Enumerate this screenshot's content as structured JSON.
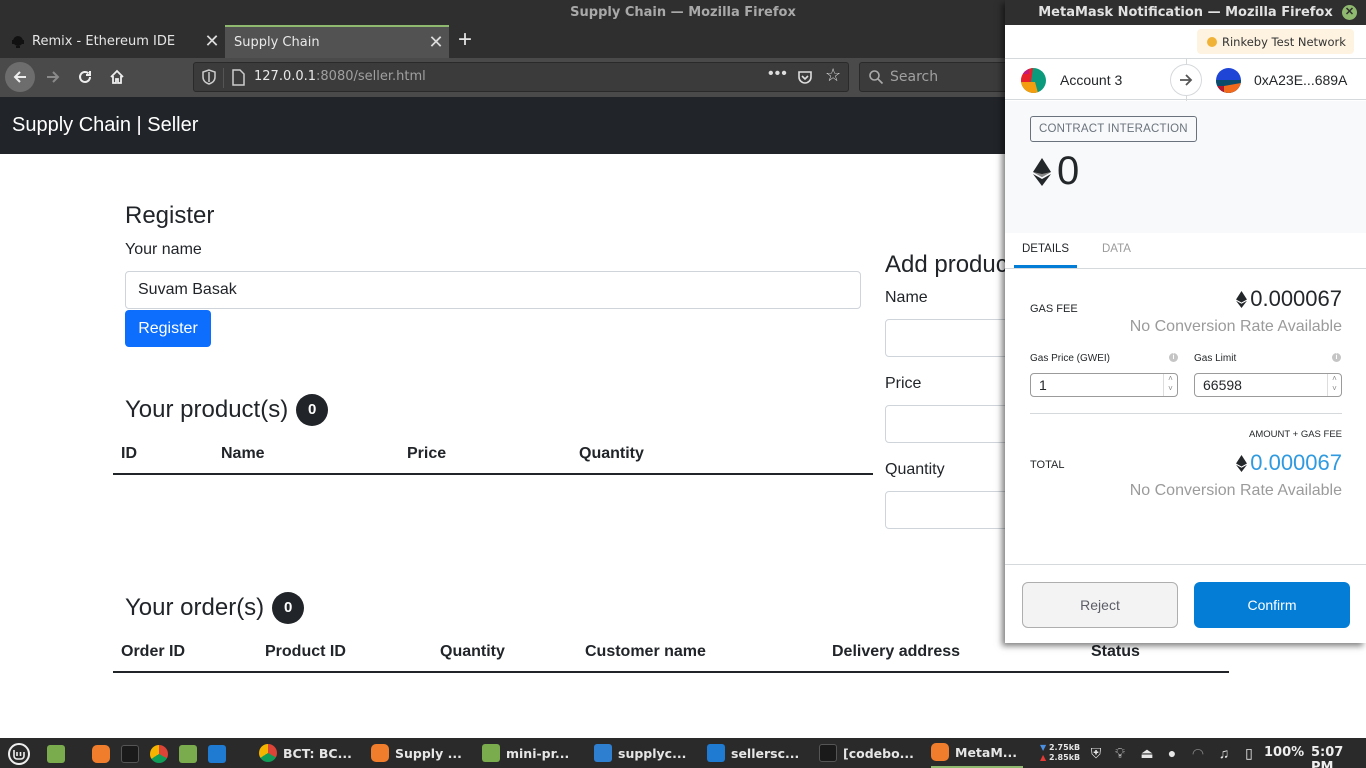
{
  "browser": {
    "window_title": "Supply Chain — Mozilla Firefox",
    "tabs": [
      {
        "label": "Remix - Ethereum IDE",
        "active": false
      },
      {
        "label": "Supply Chain",
        "active": true
      }
    ],
    "url_host": "127.0.0.1",
    "url_rest": ":8080/seller.html",
    "search_placeholder": "Search"
  },
  "page": {
    "brand": "Supply Chain | Seller",
    "register": {
      "heading": "Register",
      "name_label": "Your name",
      "name_value": "Suvam Basak",
      "button_label": "Register"
    },
    "add_product": {
      "heading": "Add product",
      "name_label": "Name",
      "name_value": "",
      "price_label": "Price",
      "price_value": "",
      "quantity_label": "Quantity",
      "quantity_value": ""
    },
    "products": {
      "heading": "Your product(s)",
      "count": "0",
      "columns": [
        "ID",
        "Name",
        "Price",
        "Quantity"
      ],
      "rows": []
    },
    "orders": {
      "heading": "Your order(s)",
      "count": "0",
      "columns": [
        "Order ID",
        "Product ID",
        "Quantity",
        "Customer name",
        "Delivery address",
        "Status"
      ],
      "rows": []
    }
  },
  "metamask": {
    "window_title": "MetaMask Notification — Mozilla Firefox",
    "network": "Rinkeby Test Network",
    "from_account": "Account 3",
    "to_address": "0xA23E...689A",
    "badge": "CONTRACT INTERACTION",
    "amount": "0",
    "tabs": [
      "DETAILS",
      "DATA"
    ],
    "gas_fee_label": "GAS FEE",
    "gas_fee_value": "0.000067",
    "no_conversion": "No Conversion Rate Available",
    "gas_price_label": "Gas Price (GWEI)",
    "gas_price_value": "1",
    "gas_limit_label": "Gas Limit",
    "gas_limit_value": "66598",
    "amount_gas_label": "AMOUNT + GAS FEE",
    "total_label": "TOTAL",
    "total_value": "0.000067",
    "reject_label": "Reject",
    "confirm_label": "Confirm",
    "colors": {
      "accent": "#037dd6",
      "total": "#2f9ae0",
      "network_dot": "#f0b338"
    }
  },
  "taskbar": {
    "items": [
      {
        "label": "BCT: BC...",
        "icon": "chrome-icon"
      },
      {
        "label": "Supply ...",
        "icon": "firefox-icon"
      },
      {
        "label": "mini-pr...",
        "icon": "folder-icon"
      },
      {
        "label": "supplyc...",
        "icon": "text-editor-icon"
      },
      {
        "label": "sellersc...",
        "icon": "vscode-icon"
      },
      {
        "label": "[codebo...",
        "icon": "terminal-icon"
      },
      {
        "label": "MetaM...",
        "icon": "firefox-icon"
      }
    ],
    "net_down": "2.75kB",
    "net_up": "2.85kB",
    "battery": "100%",
    "clock": "5:07 PM"
  }
}
